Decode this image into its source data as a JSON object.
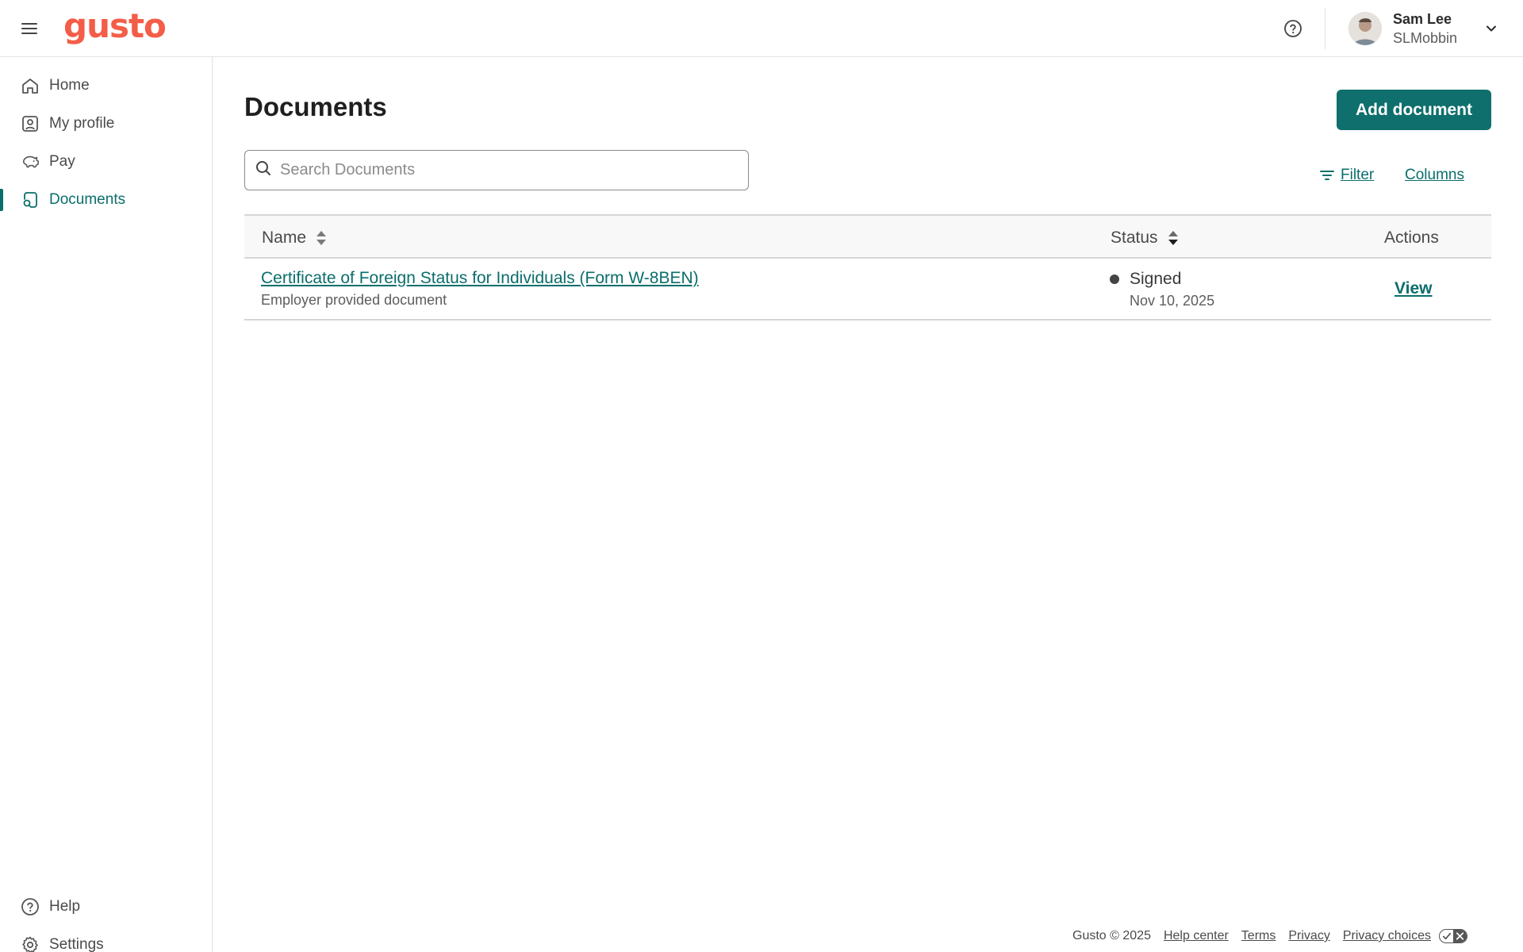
{
  "app": {
    "logo_text": "gusto",
    "brand_color": "#f45d48",
    "accent_color": "#0f6f6c"
  },
  "topbar": {
    "help_icon": "question-circle-icon",
    "user": {
      "name": "Sam Lee",
      "subtitle": "SLMobbin",
      "dropdown_icon": "chevron-down-icon"
    }
  },
  "sidebar": {
    "items": [
      {
        "label": "Home",
        "icon": "home-icon",
        "active": false
      },
      {
        "label": "My profile",
        "icon": "profile-icon",
        "active": false
      },
      {
        "label": "Pay",
        "icon": "piggy-bank-icon",
        "active": false
      },
      {
        "label": "Documents",
        "icon": "documents-icon",
        "active": true
      }
    ],
    "bottom_items": [
      {
        "label": "Help",
        "icon": "question-circle-icon"
      },
      {
        "label": "Settings",
        "icon": "gear-icon"
      }
    ]
  },
  "main": {
    "title": "Documents",
    "add_button_label": "Add document",
    "search": {
      "placeholder": "Search Documents",
      "value": ""
    },
    "filter_label": "Filter",
    "columns_label": "Columns",
    "table": {
      "headers": {
        "name": "Name",
        "status": "Status",
        "actions": "Actions"
      },
      "rows": [
        {
          "name": "Certificate of Foreign Status for Individuals (Form W-8BEN)",
          "subtitle": "Employer provided document",
          "status": "Signed",
          "date": "Nov 10, 2025",
          "action": "View"
        }
      ]
    }
  },
  "footer": {
    "copyright": "Gusto © 2025",
    "links": [
      "Help center",
      "Terms",
      "Privacy",
      "Privacy choices"
    ]
  }
}
